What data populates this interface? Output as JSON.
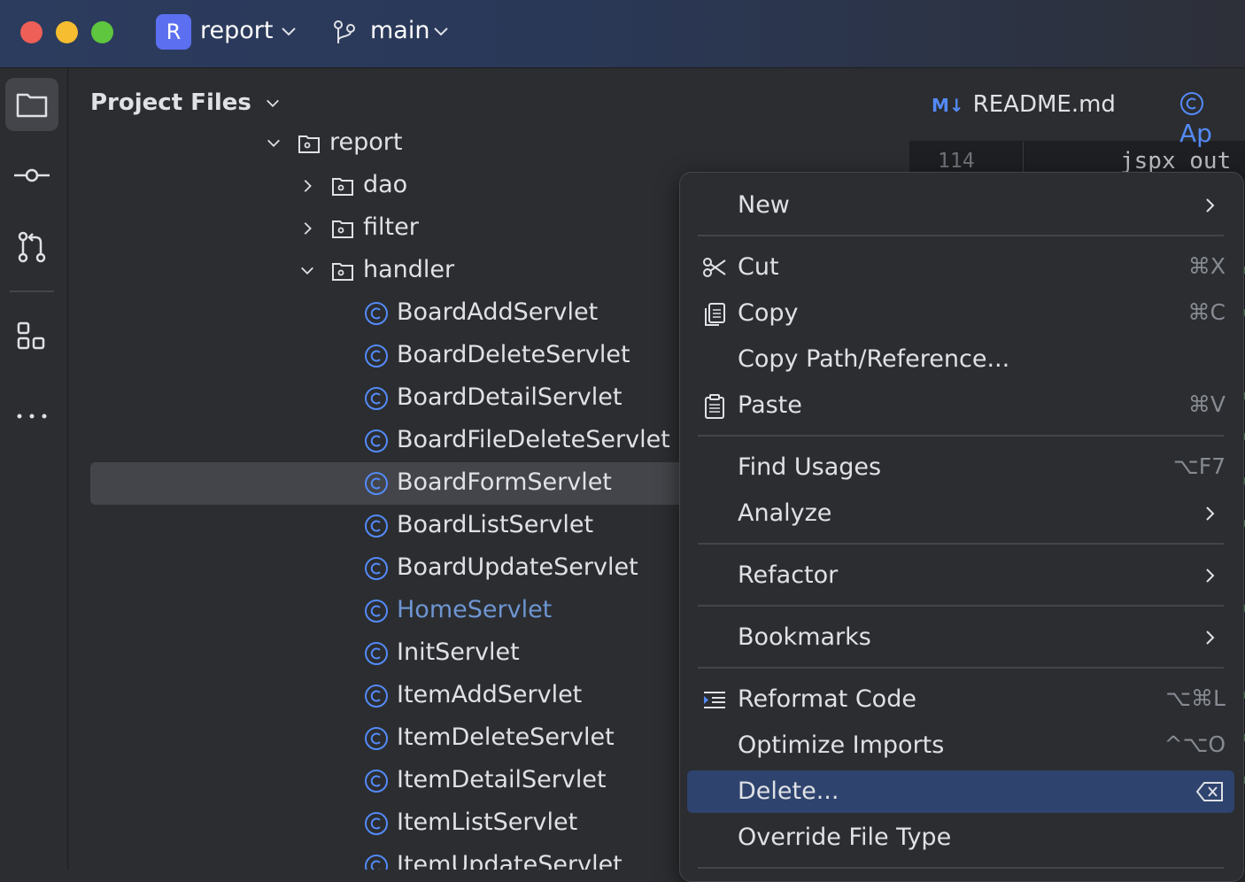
{
  "titlebar": {
    "project_badge": "R",
    "project_name": "report",
    "branch": "main"
  },
  "toolstrip": {
    "items": [
      "folder-icon",
      "commit-icon",
      "pull-request-icon",
      "plugins-icon",
      "more-icon"
    ]
  },
  "panel": {
    "title": "Project Files"
  },
  "tree": {
    "parent_folder": "report",
    "folders": [
      "dao",
      "filter",
      "handler"
    ],
    "classes": [
      "BoardAddServlet",
      "BoardDeleteServlet",
      "BoardDetailServlet",
      "BoardFileDeleteServlet",
      "BoardFormServlet",
      "BoardListServlet",
      "BoardUpdateServlet",
      "HomeServlet",
      "InitServlet",
      "ItemAddServlet",
      "ItemDeleteServlet",
      "ItemDetailServlet",
      "ItemListServlet",
      "ItemUpdateServlet"
    ],
    "selected": "BoardFormServlet"
  },
  "editor": {
    "tab_readme_badge": "M↓",
    "tab_readme": "README.md",
    "tab_second": "Ap",
    "line_number": "114",
    "code_fragment": "jspx_out ="
  },
  "context_menu": {
    "new": "New",
    "cut": "Cut",
    "cut_shortcut": "⌘X",
    "copy": "Copy",
    "copy_shortcut": "⌘C",
    "copy_path": "Copy Path/Reference...",
    "paste": "Paste",
    "paste_shortcut": "⌘V",
    "find_usages": "Find Usages",
    "find_usages_shortcut": "⌥F7",
    "analyze": "Analyze",
    "refactor": "Refactor",
    "bookmarks": "Bookmarks",
    "reformat": "Reformat Code",
    "reformat_shortcut": "⌥⌘L",
    "optimize": "Optimize Imports",
    "optimize_shortcut": "^⌥O",
    "delete": "Delete...",
    "override": "Override File Type"
  },
  "colors": {
    "menu_highlight": "#2e436e",
    "class_icon": "#548af7",
    "link_text": "#6e95d2"
  }
}
